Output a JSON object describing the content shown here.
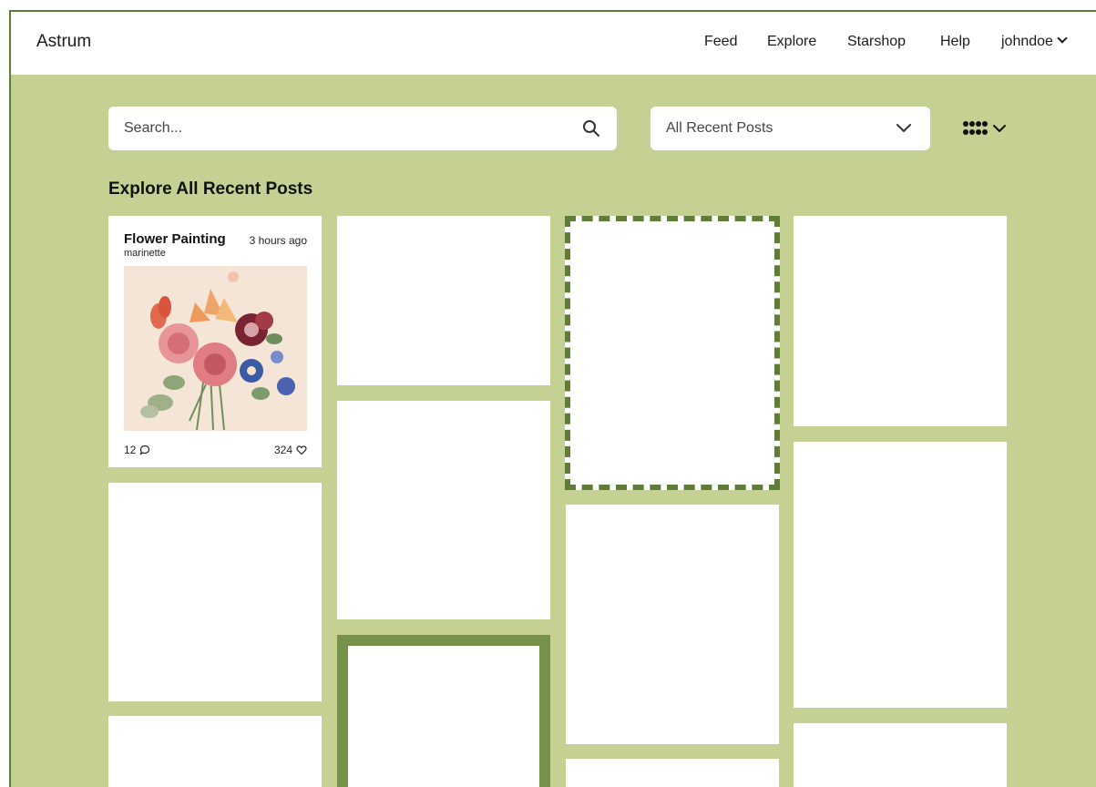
{
  "app": {
    "name": "Astrum"
  },
  "nav": {
    "links": [
      "Feed",
      "Explore",
      "Starshop",
      "Help"
    ],
    "user": "johndoe"
  },
  "search": {
    "placeholder": "Search..."
  },
  "filter": {
    "selected": "All Recent Posts"
  },
  "view_toggle": {
    "icon": "grid-icon"
  },
  "page": {
    "heading": "Explore All Recent Posts"
  },
  "featured_post": {
    "title": "Flower Painting",
    "time": "3 hours ago",
    "author": "marinette",
    "comments": "12",
    "likes": "324"
  },
  "colors": {
    "background": "#c5d093",
    "accent": "#5f7c38",
    "selected_border": "#76924a",
    "card": "#ffffff"
  }
}
